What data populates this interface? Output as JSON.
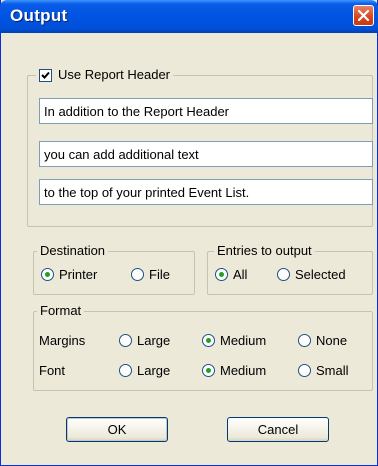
{
  "window": {
    "title": "Output"
  },
  "header_group": {
    "use_report_header_label": "Use Report Header",
    "use_report_header_checked": true,
    "lines": [
      "In addition to the Report Header",
      "you can add additional text",
      "to the top of your printed Event List."
    ]
  },
  "destination": {
    "legend": "Destination",
    "options": [
      {
        "label": "Printer",
        "selected": true
      },
      {
        "label": "File",
        "selected": false
      }
    ]
  },
  "entries": {
    "legend": "Entries to output",
    "options": [
      {
        "label": "All",
        "selected": true
      },
      {
        "label": "Selected",
        "selected": false
      }
    ]
  },
  "format": {
    "legend": "Format",
    "margins": {
      "label": "Margins",
      "options": [
        {
          "label": "Large",
          "selected": false
        },
        {
          "label": "Medium",
          "selected": true
        },
        {
          "label": "None",
          "selected": false
        }
      ]
    },
    "font": {
      "label": "Font",
      "options": [
        {
          "label": "Large",
          "selected": false
        },
        {
          "label": "Medium",
          "selected": true
        },
        {
          "label": "Small",
          "selected": false
        }
      ]
    }
  },
  "buttons": {
    "ok": "OK",
    "cancel": "Cancel"
  },
  "colors": {
    "title_bar": "#0054e3",
    "close_button": "#d7451c",
    "dialog_bg": "#ece9d8",
    "radio_dot": "#21a121"
  }
}
